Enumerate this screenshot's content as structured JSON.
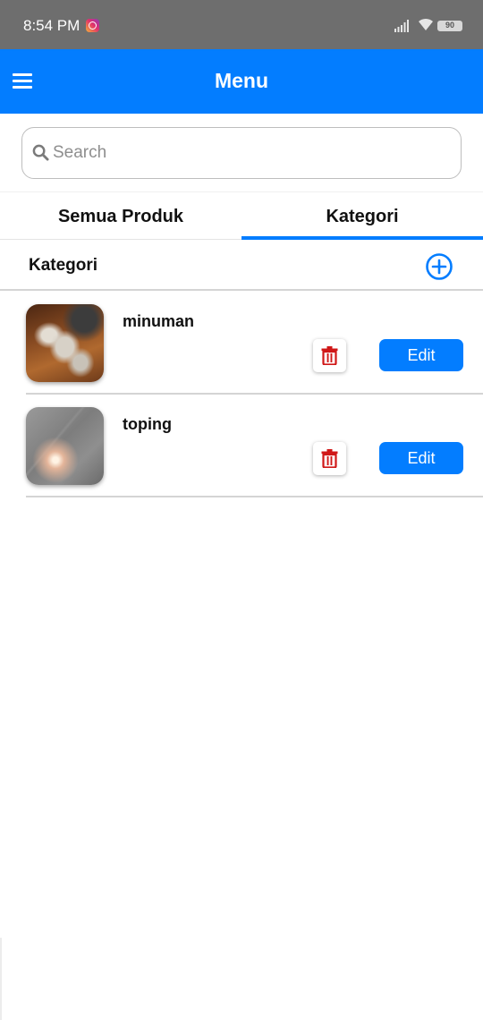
{
  "status_bar": {
    "time": "8:54 PM",
    "battery": "90",
    "icons": [
      "instagram-icon",
      "signal-icon",
      "wifi-icon",
      "battery-icon"
    ]
  },
  "app_bar": {
    "title": "Menu",
    "menu_icon": "hamburger-icon",
    "background": "#037dff"
  },
  "search": {
    "placeholder": "Search",
    "value": "",
    "icon": "search-icon"
  },
  "tabs": [
    {
      "label": "Semua Produk",
      "active": false
    },
    {
      "label": "Kategori",
      "active": true
    }
  ],
  "section": {
    "title": "Kategori",
    "add_icon": "add-circle-icon"
  },
  "categories": [
    {
      "name": "minuman",
      "image": "photo of glasses on wooden table",
      "delete_icon": "trash-icon",
      "edit_label": "Edit"
    },
    {
      "name": "toping",
      "image": "photo of grey surface with light",
      "delete_icon": "trash-icon",
      "edit_label": "Edit"
    }
  ],
  "colors": {
    "accent": "#037dff",
    "delete": "#d01818",
    "status_bar": "#6e6e6e"
  }
}
